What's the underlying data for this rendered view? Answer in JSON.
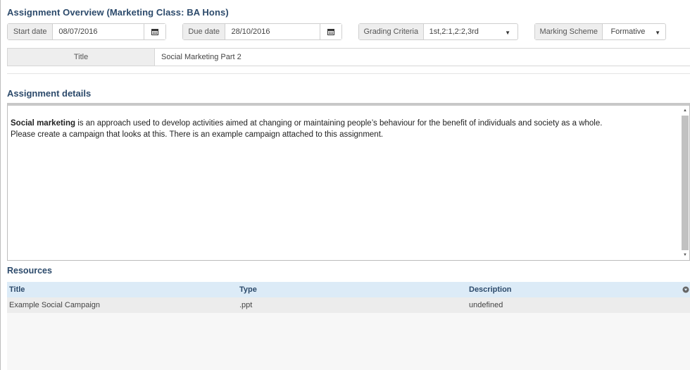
{
  "header": {
    "title": "Assignment Overview (Marketing Class: BA Hons)"
  },
  "fields": {
    "start_date": {
      "label": "Start date",
      "value": "08/07/2016"
    },
    "due_date": {
      "label": "Due date",
      "value": "28/10/2016"
    },
    "grading_criteria": {
      "label": "Grading Criteria",
      "value": "1st,2:1,2:2,3rd"
    },
    "marking_scheme": {
      "label": "Marking Scheme",
      "value": "Formative"
    },
    "title": {
      "label": "Title",
      "value": "Social Marketing Part 2"
    }
  },
  "details": {
    "heading": "Assignment details",
    "bold_lead": "Social marketing",
    "line1_rest": " is an approach used to develop activities aimed at changing or maintaining people’s behaviour for the benefit of individuals and society as a whole.",
    "line2": "Please create a campaign that looks at this. There is an example campaign attached to this assignment."
  },
  "resources": {
    "heading": "Resources",
    "columns": [
      "Title",
      "Type",
      "Description"
    ],
    "rows": [
      {
        "title": "Example Social Campaign",
        "type": ".ppt",
        "description": "undefined"
      }
    ]
  },
  "icons": {
    "calendar": "calendar-icon",
    "dropdown": "caret-down-icon",
    "filter": "filter-icon"
  },
  "colors": {
    "heading": "#2c4a6b",
    "table_header": "#dcebf7",
    "addon_bg": "#eeeeee"
  }
}
